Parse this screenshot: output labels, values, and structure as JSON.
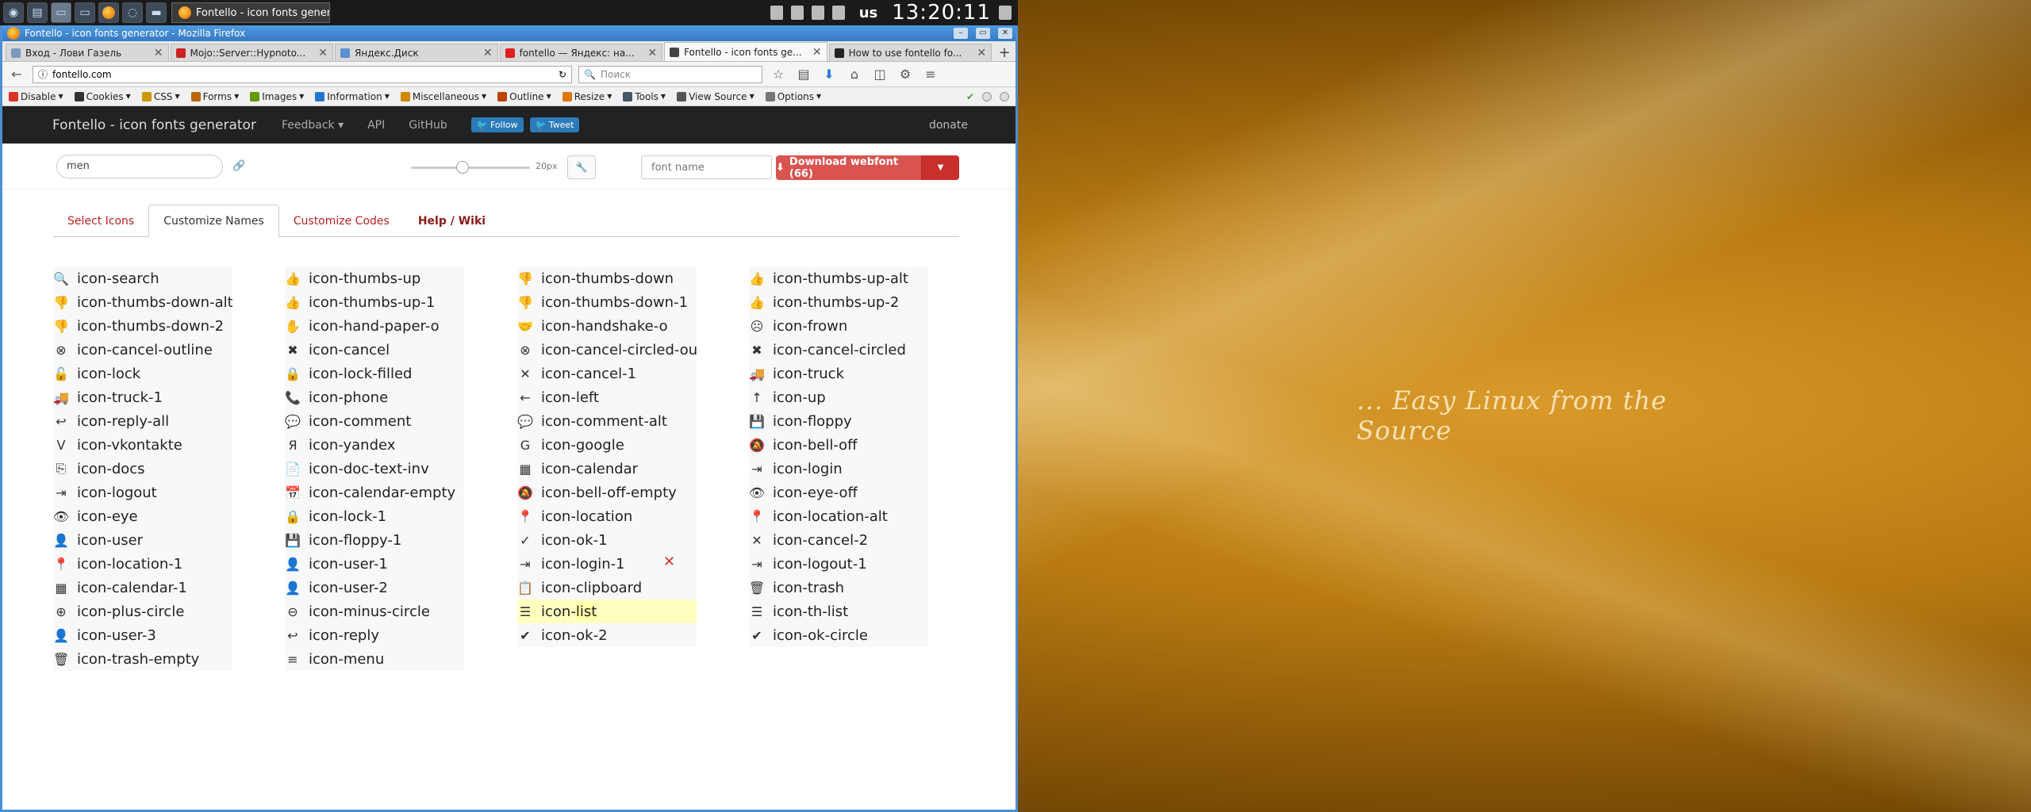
{
  "taskbar": {
    "task_title": "Fontello - icon fonts genera...",
    "keyboard_layout": "us",
    "clock": "13:20:11"
  },
  "window": {
    "title": "Fontello - icon fonts generator - Mozilla Firefox"
  },
  "browser_tabs": [
    {
      "label": "Вход - Лови Газель",
      "favicon_color": "#7a9abf"
    },
    {
      "label": "Mojo::Server::Hypnoto...",
      "favicon_color": "#cc2222"
    },
    {
      "label": "Яндекс.Диск",
      "favicon_color": "#5a8fd0"
    },
    {
      "label": "fontello — Яндекс: на...",
      "favicon_color": "#e02020"
    },
    {
      "label": "Fontello - icon fonts ge...",
      "favicon_color": "#444444",
      "active": true
    },
    {
      "label": "How to use fontello fo...",
      "favicon_color": "#222222"
    }
  ],
  "navbar": {
    "url": "fontello.com",
    "search_placeholder": "Поиск"
  },
  "addon_bar": {
    "items": [
      "Disable",
      "Cookies",
      "CSS",
      "Forms",
      "Images",
      "Information",
      "Miscellaneous",
      "Outline",
      "Resize",
      "Tools",
      "View Source",
      "Options"
    ]
  },
  "site": {
    "brand": "Fontello - icon fonts generator",
    "links": [
      "Feedback",
      "API",
      "GitHub"
    ],
    "follow_label": "Follow",
    "tweet_label": "Tweet",
    "donate": "donate"
  },
  "toolbar": {
    "search_value": "men",
    "size_label": "20px",
    "size_value": 20,
    "font_name_placeholder": "font name",
    "download_label": "Download webfont (66)"
  },
  "tabs": [
    {
      "label": "Select Icons"
    },
    {
      "label": "Customize Names",
      "active": true
    },
    {
      "label": "Customize Codes"
    },
    {
      "label": "Help / Wiki",
      "bold": true
    }
  ],
  "columns": [
    [
      {
        "glyph": "🔍",
        "name": "icon-search"
      },
      {
        "glyph": "👎",
        "name": "icon-thumbs-down-alt"
      },
      {
        "glyph": "👎",
        "name": "icon-thumbs-down-2"
      },
      {
        "glyph": "⊗",
        "name": "icon-cancel-outline"
      },
      {
        "glyph": "🔓",
        "name": "icon-lock"
      },
      {
        "glyph": "🚚",
        "name": "icon-truck-1"
      },
      {
        "glyph": "↩",
        "name": "icon-reply-all"
      },
      {
        "glyph": "ᐯ",
        "name": "icon-vkontakte"
      },
      {
        "glyph": "⎘",
        "name": "icon-docs"
      },
      {
        "glyph": "⇥",
        "name": "icon-logout"
      },
      {
        "glyph": "👁",
        "name": "icon-eye"
      },
      {
        "glyph": "👤",
        "name": "icon-user"
      },
      {
        "glyph": "📍",
        "name": "icon-location-1"
      },
      {
        "glyph": "▦",
        "name": "icon-calendar-1"
      },
      {
        "glyph": "⊕",
        "name": "icon-plus-circle"
      },
      {
        "glyph": "👤",
        "name": "icon-user-3"
      },
      {
        "glyph": "🗑",
        "name": "icon-trash-empty"
      }
    ],
    [
      {
        "glyph": "👍",
        "name": "icon-thumbs-up"
      },
      {
        "glyph": "👍",
        "name": "icon-thumbs-up-1"
      },
      {
        "glyph": "✋",
        "name": "icon-hand-paper-o"
      },
      {
        "glyph": "✖",
        "name": "icon-cancel"
      },
      {
        "glyph": "🔒",
        "name": "icon-lock-filled"
      },
      {
        "glyph": "📞",
        "name": "icon-phone"
      },
      {
        "glyph": "💬",
        "name": "icon-comment"
      },
      {
        "glyph": "Я",
        "name": "icon-yandex"
      },
      {
        "glyph": "📄",
        "name": "icon-doc-text-inv"
      },
      {
        "glyph": "📅",
        "name": "icon-calendar-empty"
      },
      {
        "glyph": "🔒",
        "name": "icon-lock-1"
      },
      {
        "glyph": "💾",
        "name": "icon-floppy-1"
      },
      {
        "glyph": "👤",
        "name": "icon-user-1"
      },
      {
        "glyph": "👤",
        "name": "icon-user-2"
      },
      {
        "glyph": "⊖",
        "name": "icon-minus-circle"
      },
      {
        "glyph": "↩",
        "name": "icon-reply"
      },
      {
        "glyph": "≡",
        "name": "icon-menu"
      }
    ],
    [
      {
        "glyph": "👎",
        "name": "icon-thumbs-down"
      },
      {
        "glyph": "👎",
        "name": "icon-thumbs-down-1"
      },
      {
        "glyph": "🤝",
        "name": "icon-handshake-o"
      },
      {
        "glyph": "⊗",
        "name": "icon-cancel-circled-ou"
      },
      {
        "glyph": "✕",
        "name": "icon-cancel-1"
      },
      {
        "glyph": "←",
        "name": "icon-left"
      },
      {
        "glyph": "💬",
        "name": "icon-comment-alt"
      },
      {
        "glyph": "G",
        "name": "icon-google"
      },
      {
        "glyph": "▦",
        "name": "icon-calendar"
      },
      {
        "glyph": "🔕",
        "name": "icon-bell-off-empty"
      },
      {
        "glyph": "📍",
        "name": "icon-location"
      },
      {
        "glyph": "✓",
        "name": "icon-ok-1"
      },
      {
        "glyph": "⇥",
        "name": "icon-login-1"
      },
      {
        "glyph": "📋",
        "name": "icon-clipboard"
      },
      {
        "glyph": "☰",
        "name_prefix": "icon-",
        "name_highlight": "list",
        "highlighted": true
      },
      {
        "glyph": "✔",
        "name": "icon-ok-2"
      }
    ],
    [
      {
        "glyph": "👍",
        "name": "icon-thumbs-up-alt"
      },
      {
        "glyph": "👍",
        "name": "icon-thumbs-up-2"
      },
      {
        "glyph": "☹",
        "name": "icon-frown"
      },
      {
        "glyph": "✖",
        "name": "icon-cancel-circled"
      },
      {
        "glyph": "🚚",
        "name": "icon-truck"
      },
      {
        "glyph": "↑",
        "name": "icon-up"
      },
      {
        "glyph": "💾",
        "name": "icon-floppy"
      },
      {
        "glyph": "🔕",
        "name": "icon-bell-off"
      },
      {
        "glyph": "⇥",
        "name": "icon-login"
      },
      {
        "glyph": "👁",
        "name": "icon-eye-off"
      },
      {
        "glyph": "📍",
        "name": "icon-location-alt"
      },
      {
        "glyph": "✕",
        "name": "icon-cancel-2"
      },
      {
        "glyph": "⇥",
        "name": "icon-logout-1"
      },
      {
        "glyph": "🗑",
        "name": "icon-trash"
      },
      {
        "glyph": "☰",
        "name": "icon-th-list"
      },
      {
        "glyph": "✔",
        "name": "icon-ok-circle"
      }
    ]
  ],
  "desktop": {
    "tagline": "... Easy Linux from the Source"
  }
}
